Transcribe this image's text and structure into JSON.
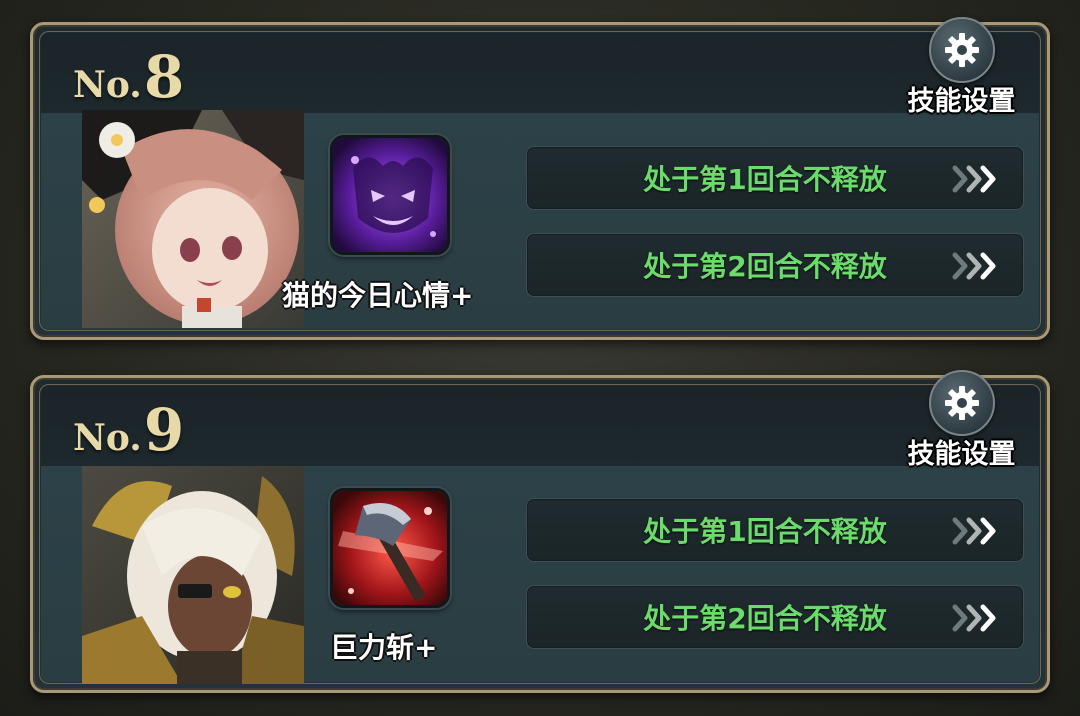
{
  "cards": [
    {
      "number_prefix": "No.",
      "number": "8",
      "settings_label": "技能设置",
      "skill_name": "猫的今日心情+",
      "actions": [
        {
          "label": "处于第1回合不释放"
        },
        {
          "label": "处于第2回合不释放"
        }
      ]
    },
    {
      "number_prefix": "No.",
      "number": "9",
      "settings_label": "技能设置",
      "skill_name": "巨力斩+",
      "actions": [
        {
          "label": "处于第1回合不释放"
        },
        {
          "label": "处于第2回合不释放"
        }
      ]
    }
  ],
  "colors": {
    "action_text": "#6bdb6b",
    "number_gold": "#e8d9a8",
    "frame_gold": "#a89a78"
  },
  "icons": {
    "settings": "gear-icon",
    "row_arrow": "triple-chevron-right-icon"
  }
}
